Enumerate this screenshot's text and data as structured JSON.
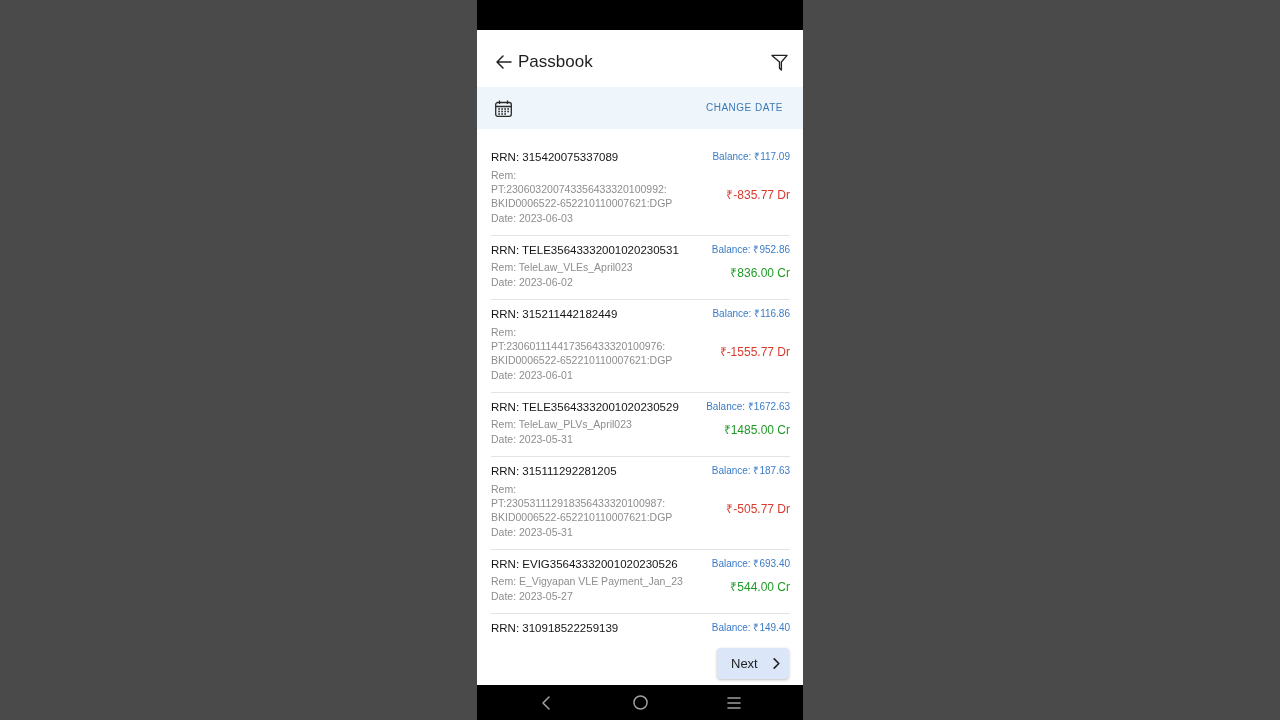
{
  "header": {
    "title": "Passbook"
  },
  "date_bar": {
    "action": "CHANGE DATE"
  },
  "transactions": [
    {
      "rrn": "RRN: 315420075337089",
      "remark": "Rem: PT:230603200743356433320100992: BKID0006522-652210110007621:DGP",
      "date": "Date: 2023-06-03",
      "balance": "Balance: ₹117.09",
      "amount": "₹-835.77 Dr",
      "kind": "debit"
    },
    {
      "rrn": "RRN: TELE35643332001020230531",
      "remark": "Rem: TeleLaw_VLEs_April023",
      "date": "Date: 2023-06-02",
      "balance": "Balance: ₹952.86",
      "amount": "₹836.00 Cr",
      "kind": "credit"
    },
    {
      "rrn": "RRN: 315211442182449",
      "remark": "Rem: PT:230601114417356433320100976: BKID0006522-652210110007621:DGP",
      "date": "Date: 2023-06-01",
      "balance": "Balance: ₹116.86",
      "amount": "₹-1555.77 Dr",
      "kind": "debit"
    },
    {
      "rrn": "RRN: TELE35643332001020230529",
      "remark": "Rem: TeleLaw_PLVs_April023",
      "date": "Date: 2023-05-31",
      "balance": "Balance: ₹1672.63",
      "amount": "₹1485.00 Cr",
      "kind": "credit"
    },
    {
      "rrn": "RRN: 315111292281205",
      "remark": "Rem: PT:230531112918356433320100987: BKID0006522-652210110007621:DGP",
      "date": "Date: 2023-05-31",
      "balance": "Balance: ₹187.63",
      "amount": "₹-505.77 Dr",
      "kind": "debit"
    },
    {
      "rrn": "RRN: EVIG35643332001020230526",
      "remark": "Rem: E_Vigyapan VLE Payment_Jan_23",
      "date": "Date: 2023-05-27",
      "balance": "Balance: ₹693.40",
      "amount": "₹544.00 Cr",
      "kind": "credit"
    },
    {
      "rrn": "RRN: 310918522259139",
      "balance": "Balance: ₹149.40"
    }
  ],
  "pager": {
    "next": "Next"
  }
}
